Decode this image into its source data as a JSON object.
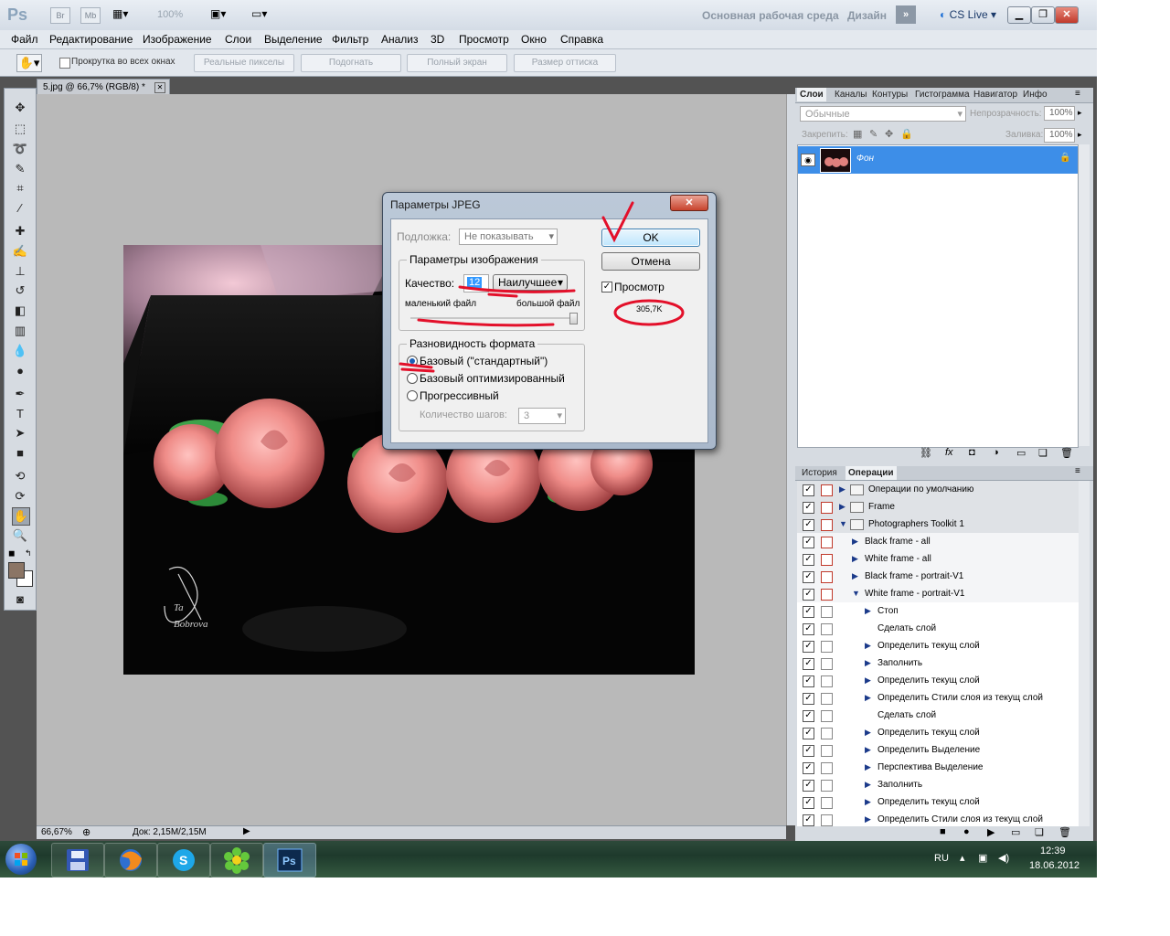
{
  "titlebar": {
    "app_logo": "Ps",
    "bridge_btn": "Br",
    "minibridge_btn": "Mb",
    "zoom": "100%",
    "workspace": "Основная рабочая среда",
    "design": "Дизайн",
    "cs_live": "CS Live"
  },
  "menu": [
    "Файл",
    "Редактирование",
    "Изображение",
    "Слои",
    "Выделение",
    "Фильтр",
    "Анализ",
    "3D",
    "Просмотр",
    "Окно",
    "Справка"
  ],
  "options": {
    "scroll_all": "Прокрутка во всех окнах",
    "actual_pixels": "Реальные пикселы",
    "fit_screen": "Подогнать",
    "fill_screen": "Полный экран",
    "print_size": "Размер оттиска"
  },
  "document": {
    "tab_title": "5.jpg @ 66,7% (RGB/8) *",
    "zoom": "66,67%",
    "doc_info": "Док: 2,15M/2,15M",
    "watermark": "Ta Bobrova"
  },
  "layers_panel": {
    "tabs": [
      "Слои",
      "Каналы",
      "Контуры",
      "Гистограмма",
      "Навигатор",
      "Инфо"
    ],
    "blend_mode": "Обычные",
    "opacity_label": "Непрозрачность:",
    "opacity_value": "100%",
    "lock_label": "Закрепить:",
    "fill_label": "Заливка:",
    "fill_value": "100%",
    "layer_name": "Фон"
  },
  "actions_panel": {
    "tabs": [
      "История",
      "Операции"
    ],
    "rows": [
      {
        "label": "Операции по умолчанию",
        "level": 0,
        "type": "folder",
        "arrow": "right"
      },
      {
        "label": "Frame",
        "level": 0,
        "type": "folder",
        "arrow": "right"
      },
      {
        "label": "Photographers Toolkit 1",
        "level": 0,
        "type": "folder",
        "arrow": "down"
      },
      {
        "label": "Black frame - all",
        "level": 1,
        "type": "action",
        "arrow": "right"
      },
      {
        "label": "White frame - all",
        "level": 1,
        "type": "action",
        "arrow": "right"
      },
      {
        "label": "Black frame - portrait-V1",
        "level": 1,
        "type": "action",
        "arrow": "right"
      },
      {
        "label": "White frame - portrait-V1",
        "level": 1,
        "type": "action",
        "arrow": "down"
      },
      {
        "label": "Стоп",
        "level": 2,
        "type": "step",
        "arrow": "right"
      },
      {
        "label": "Сделать слой",
        "level": 2,
        "type": "step",
        "arrow": ""
      },
      {
        "label": "Определить текущ слой",
        "level": 2,
        "type": "step",
        "arrow": "right"
      },
      {
        "label": "Заполнить",
        "level": 2,
        "type": "step",
        "arrow": "right"
      },
      {
        "label": "Определить текущ слой",
        "level": 2,
        "type": "step",
        "arrow": "right"
      },
      {
        "label": "Определить Стили слоя из текущ слой",
        "level": 2,
        "type": "step",
        "arrow": "right"
      },
      {
        "label": "Сделать слой",
        "level": 2,
        "type": "step",
        "arrow": ""
      },
      {
        "label": "Определить текущ слой",
        "level": 2,
        "type": "step",
        "arrow": "right"
      },
      {
        "label": "Определить Выделение",
        "level": 2,
        "type": "step",
        "arrow": "right"
      },
      {
        "label": "Перспектива Выделение",
        "level": 2,
        "type": "step",
        "arrow": "right"
      },
      {
        "label": "Заполнить",
        "level": 2,
        "type": "step",
        "arrow": "right"
      },
      {
        "label": "Определить текущ слой",
        "level": 2,
        "type": "step",
        "arrow": "right"
      },
      {
        "label": "Определить Стили слоя из текущ слой",
        "level": 2,
        "type": "step",
        "arrow": "right"
      }
    ]
  },
  "dialog": {
    "title": "Параметры JPEG",
    "matte_label": "Подложка:",
    "matte_value": "Не показывать",
    "image_options": "Параметры изображения",
    "quality_label": "Качество:",
    "quality_value": "12",
    "quality_preset": "Наилучшее",
    "small_file": "маленький файл",
    "large_file": "большой файл",
    "format_options": "Разновидность формата",
    "baseline_standard": "Базовый (\"стандартный\")",
    "baseline_optimized": "Базовый оптимизированный",
    "progressive": "Прогрессивный",
    "scans_label": "Количество шагов:",
    "scans_value": "3",
    "ok": "OK",
    "cancel": "Отмена",
    "preview": "Просмотр",
    "file_size": "305,7K",
    "quality_fraction": 1.0
  },
  "taskbar": {
    "lang": "RU",
    "time": "12:39",
    "date": "18.06.2012"
  },
  "colors": {
    "selected_layer": "#3d8ee8",
    "annotation_red": "#e3102a",
    "foreground": "#8b7565"
  }
}
